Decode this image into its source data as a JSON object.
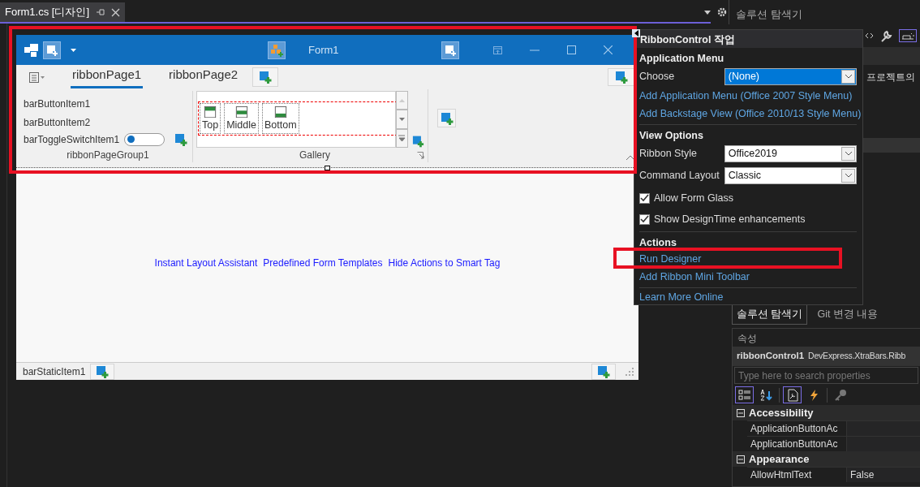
{
  "document_tab": {
    "title": "Form1.cs [디자인]",
    "selected": true
  },
  "form": {
    "title": "Form1",
    "highlighted": true,
    "ribbon_pages": [
      {
        "label": "ribbonPage1",
        "selected": true
      },
      {
        "label": "ribbonPage2",
        "selected": false
      }
    ],
    "group": {
      "caption": "ribbonPageGroup1",
      "items": [
        {
          "kind": "button",
          "label": "barButtonItem1"
        },
        {
          "kind": "button",
          "label": "barButtonItem2"
        },
        {
          "kind": "toggle",
          "label": "barToggleSwitchItem1",
          "on": false
        }
      ]
    },
    "gallery": {
      "caption": "Gallery",
      "items": [
        {
          "label": "Top",
          "kind": "top"
        },
        {
          "label": "Middle",
          "kind": "middle"
        },
        {
          "label": "Bottom",
          "kind": "bottom"
        }
      ]
    },
    "links": [
      "Instant Layout Assistant",
      "Predefined Form Templates",
      "Hide Actions to Smart Tag"
    ],
    "status_bar": {
      "item": "barStaticItem1"
    }
  },
  "smart_tag": {
    "title": "RibbonControl 작업",
    "sections": [
      {
        "heading": "Application Menu",
        "items": [
          {
            "kind": "combo",
            "label": "Choose",
            "value": "(None)",
            "focused": true
          },
          {
            "kind": "link",
            "label": "Add Application Menu (Office 2007 Style Menu)",
            "highlighted": false
          },
          {
            "kind": "link",
            "label": "Add Backstage View (Office 2010/13 Style Menu)",
            "highlighted": false
          }
        ]
      },
      {
        "heading": "View Options",
        "items": [
          {
            "kind": "combo",
            "label": "Ribbon Style",
            "value": "Office2019",
            "focused": false
          },
          {
            "kind": "combo",
            "label": "Command Layout",
            "value": "Classic",
            "focused": false
          },
          {
            "kind": "check",
            "label": "Allow Form Glass",
            "checked": true
          },
          {
            "kind": "check",
            "label": "Show DesignTime enhancements",
            "checked": true
          }
        ]
      },
      {
        "heading": "Actions",
        "items": [
          {
            "kind": "link",
            "label": "Run Designer",
            "highlighted": true
          },
          {
            "kind": "link",
            "label": "Add Ribbon Mini Toolbar",
            "highlighted": false
          }
        ]
      },
      {
        "items": [
          {
            "kind": "link",
            "label": "Learn More Online",
            "highlighted": false
          }
        ]
      }
    ]
  },
  "solution_explorer": {
    "title": "솔루션 탐색기",
    "text": "프로젝트의"
  },
  "bottom_tabs": [
    {
      "label": "솔루션 탐색기",
      "selected": true
    },
    {
      "label": "Git 변경 내용",
      "selected": false
    }
  ],
  "properties": {
    "title": "속성",
    "object": "ribbonControl1",
    "type": "DevExpress.XtraBars.Ribb",
    "placeholder": "Type here to search properties",
    "toolbar": [
      {
        "kind": "categorized",
        "selected": true
      },
      {
        "kind": "alphabetical",
        "selected": false
      },
      {
        "kind": "properties",
        "selected": true
      },
      {
        "kind": "events",
        "selected": false
      },
      {
        "kind": "pages",
        "selected": false
      }
    ],
    "categories": [
      {
        "name": "Accessibility",
        "expanded": true,
        "rows": [
          {
            "name": "ApplicationButtonAc",
            "value": ""
          },
          {
            "name": "ApplicationButtonAc",
            "value": ""
          }
        ]
      },
      {
        "name": "Appearance",
        "expanded": true,
        "rows": [
          {
            "name": "AllowHtmlText",
            "value": "False"
          }
        ]
      }
    ]
  }
}
